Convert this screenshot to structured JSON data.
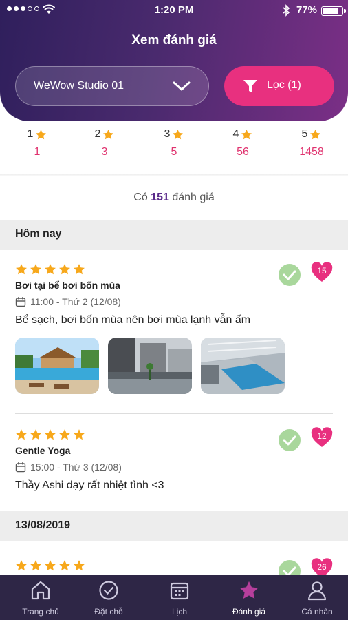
{
  "status": {
    "time": "1:20 PM",
    "battery": "77%"
  },
  "header": {
    "title": "Xem đánh giá",
    "studio": "WeWow Studio 01",
    "filter_label": "Lọc (1)"
  },
  "ratings": [
    {
      "stars": "1",
      "count": "1"
    },
    {
      "stars": "2",
      "count": "3"
    },
    {
      "stars": "3",
      "count": "5"
    },
    {
      "stars": "4",
      "count": "56"
    },
    {
      "stars": "5",
      "count": "1458"
    }
  ],
  "summary": {
    "prefix": "Có",
    "count": "151",
    "suffix": "đánh giá"
  },
  "sections": [
    {
      "label": "Hôm nay",
      "reviews": [
        {
          "rating": 5,
          "name": "Bơi tại bể bơi bốn mùa",
          "time": "11:00 - Thứ 2 (12/08)",
          "text": "Bể sạch, bơi bốn mùa nên bơi mùa lạnh vẫn ấm",
          "likes": "15"
        },
        {
          "rating": 5,
          "name": "Gentle Yoga",
          "time": "15:00 - Thứ 3 (12/08)",
          "text": "Thầy Ashi dạy rất nhiệt tình <3",
          "likes": "12"
        }
      ]
    },
    {
      "label": "13/08/2019",
      "reviews": [
        {
          "rating": 5,
          "likes": "26"
        }
      ]
    }
  ],
  "nav": [
    {
      "label": "Trang chủ",
      "icon": "home-icon"
    },
    {
      "label": "Đặt chỗ",
      "icon": "check-circle-icon"
    },
    {
      "label": "Lịch",
      "icon": "calendar-icon"
    },
    {
      "label": "Đánh giá",
      "icon": "star-icon",
      "active": true
    },
    {
      "label": "Cá nhân",
      "icon": "user-icon"
    }
  ],
  "colors": {
    "accent": "#e8307f",
    "star": "#f7a81b",
    "check": "#a9d79c",
    "nav_bg": "#2e2646",
    "header_from": "#2f1f5c",
    "header_to": "#7b2f86"
  }
}
